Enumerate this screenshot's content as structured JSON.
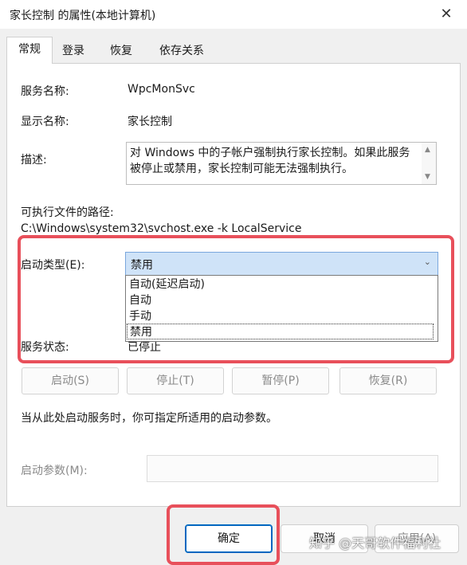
{
  "window": {
    "title": "家长控制 的属性(本地计算机)"
  },
  "icons": {
    "close": "close-icon",
    "scroll_up": "scroll-up-icon",
    "scroll_down": "scroll-down-icon",
    "dropdown": "chevron-down-icon"
  },
  "tabs": [
    "常规",
    "登录",
    "恢复",
    "依存关系"
  ],
  "general": {
    "service_name_label": "服务名称:",
    "service_name_value": "WpcMonSvc",
    "display_name_label": "显示名称:",
    "display_name_value": "家长控制",
    "description_label": "描述:",
    "description_value": "对 Windows 中的子帐户强制执行家长控制。如果此服务被停止或禁用，家长控制可能无法强制执行。",
    "exe_path_label": "可执行文件的路径:",
    "exe_path_value": "C:\\Windows\\system32\\svchost.exe -k LocalService",
    "startup_type_label": "启动类型(E):",
    "startup_type_value": "禁用",
    "startup_options": [
      "自动(延迟启动)",
      "自动",
      "手动",
      "禁用"
    ],
    "service_status_label": "服务状态:",
    "service_status_value": "已停止",
    "buttons": {
      "start": "启动(S)",
      "stop": "停止(T)",
      "pause": "暂停(P)",
      "resume": "恢复(R)"
    },
    "hint": "当从此处启动服务时，你可指定所适用的启动参数。",
    "start_params_label": "启动参数(M):",
    "start_params_value": ""
  },
  "footer": {
    "ok": "确定",
    "cancel": "取消",
    "apply": "应用(A)"
  },
  "watermark": "知乎 @天哥软件福利社",
  "colors": {
    "highlight_box": "#e8505b",
    "select_bg": "#cfe3f8"
  }
}
